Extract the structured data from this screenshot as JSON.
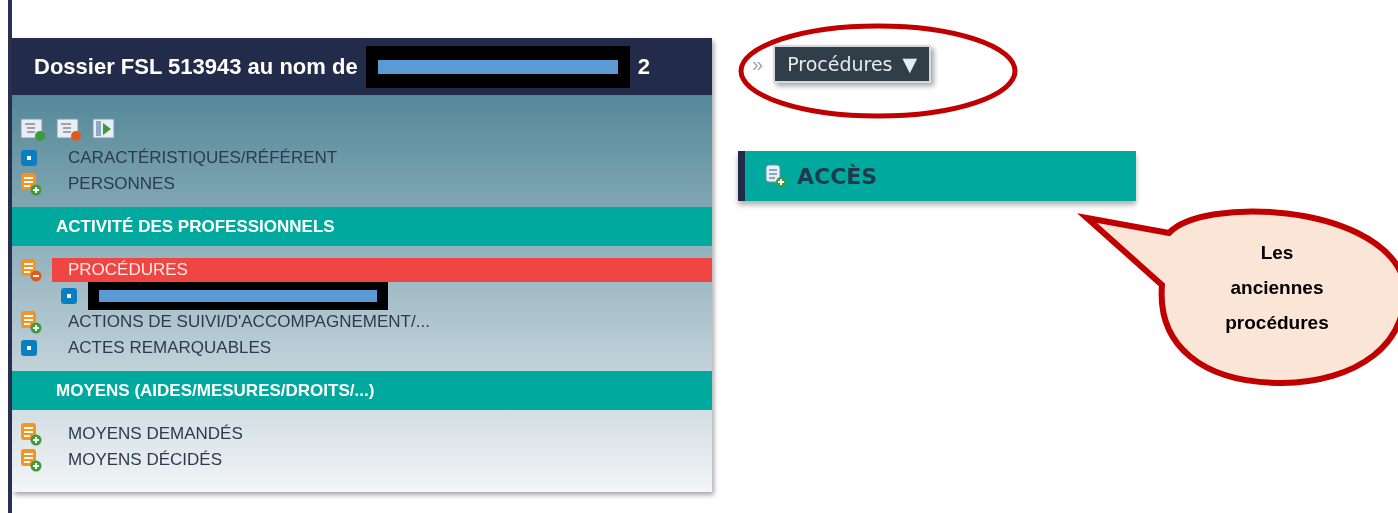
{
  "panel": {
    "title": "Dossier FSL 513943 au nom de",
    "title_end": "2",
    "items": [
      {
        "kind": "dot",
        "label": "CARACTÉRISTIQUES/RÉFÉRENT",
        "selected": false
      },
      {
        "kind": "add",
        "label": "PERSONNES",
        "selected": false
      },
      {
        "kind": "section",
        "label": "ACTIVITÉ DES PROFESSIONNELS"
      },
      {
        "kind": "remove",
        "label": "PROCÉDURES",
        "selected": true
      },
      {
        "kind": "redacted"
      },
      {
        "kind": "add",
        "label": "ACTIONS DE SUIVI/D'ACCOMPAGNEMENT/...",
        "selected": false
      },
      {
        "kind": "dot",
        "label": "ACTES REMARQUABLES",
        "selected": false
      },
      {
        "kind": "section",
        "label": "MOYENS (AIDES/MESURES/DROITS/...)"
      },
      {
        "kind": "add",
        "label": "MOYENS DEMANDÉS",
        "selected": false
      },
      {
        "kind": "add",
        "label": "MOYENS DÉCIDÉS",
        "selected": false
      }
    ]
  },
  "breadcrumb": {
    "separator": "»",
    "menu": "Procédures",
    "caret": "▼"
  },
  "access_bar": {
    "label": "ACCÈS"
  },
  "callout": {
    "text": "Les anciennes procédures"
  }
}
